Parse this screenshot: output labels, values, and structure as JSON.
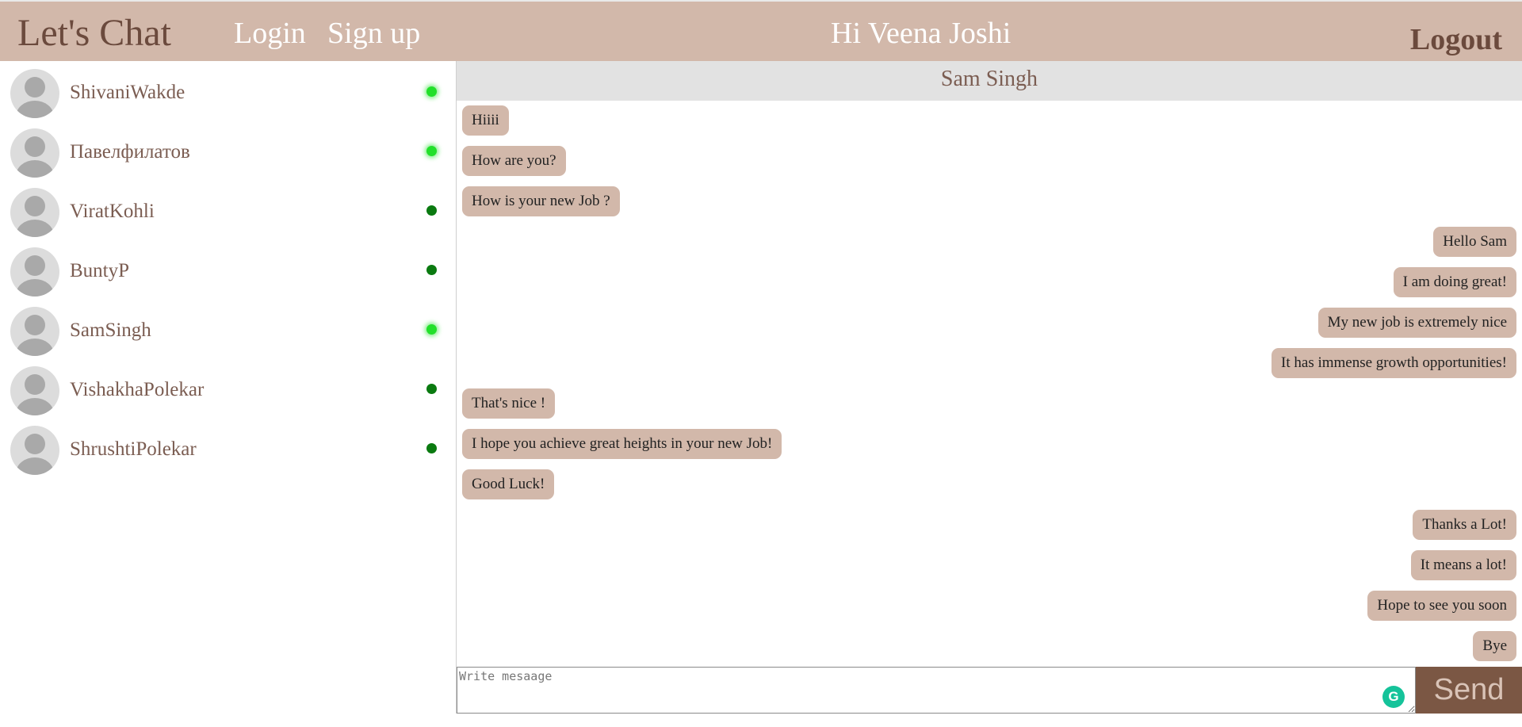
{
  "header": {
    "brand": "Let's Chat",
    "login": "Login",
    "signup": "Sign up",
    "greeting": "Hi Veena Joshi",
    "logout": "Logout"
  },
  "contacts": [
    {
      "name": "ShivaniWakde",
      "status": "online"
    },
    {
      "name": "Павелфилатов",
      "status": "online"
    },
    {
      "name": "ViratKohli",
      "status": "offline"
    },
    {
      "name": "BuntyP",
      "status": "offline"
    },
    {
      "name": "SamSingh",
      "status": "online"
    },
    {
      "name": "VishakhaPolekar",
      "status": "offline"
    },
    {
      "name": "ShrushtiPolekar",
      "status": "offline"
    }
  ],
  "chat": {
    "title": "Sam Singh",
    "messages": [
      {
        "text": "Hiiii",
        "direction": "in"
      },
      {
        "text": "How are you?",
        "direction": "in"
      },
      {
        "text": "How is your new Job ?",
        "direction": "in"
      },
      {
        "text": "Hello Sam",
        "direction": "out"
      },
      {
        "text": "I am doing great!",
        "direction": "out"
      },
      {
        "text": "My new job is extremely nice",
        "direction": "out"
      },
      {
        "text": "It has immense growth opportunities!",
        "direction": "out"
      },
      {
        "text": "That's nice !",
        "direction": "in"
      },
      {
        "text": "I hope you achieve great heights in your new Job!",
        "direction": "in"
      },
      {
        "text": "Good Luck!",
        "direction": "in"
      },
      {
        "text": "Thanks a Lot!",
        "direction": "out"
      },
      {
        "text": "It means a lot!",
        "direction": "out"
      },
      {
        "text": "Hope to see you soon",
        "direction": "out"
      },
      {
        "text": "Bye",
        "direction": "out"
      }
    ]
  },
  "composer": {
    "placeholder": "Write mesaage",
    "value": "",
    "send_label": "Send",
    "grammarly_icon": "grammarly-icon"
  },
  "colors": {
    "header_bg": "#d2b8aa",
    "bubble_bg": "#d2b8aa",
    "brand_text": "#6b4a3d",
    "online": "#22e02a",
    "offline": "#0a7a10",
    "send_bg": "#7b5744",
    "chat_header_bg": "#e2e2e2"
  }
}
